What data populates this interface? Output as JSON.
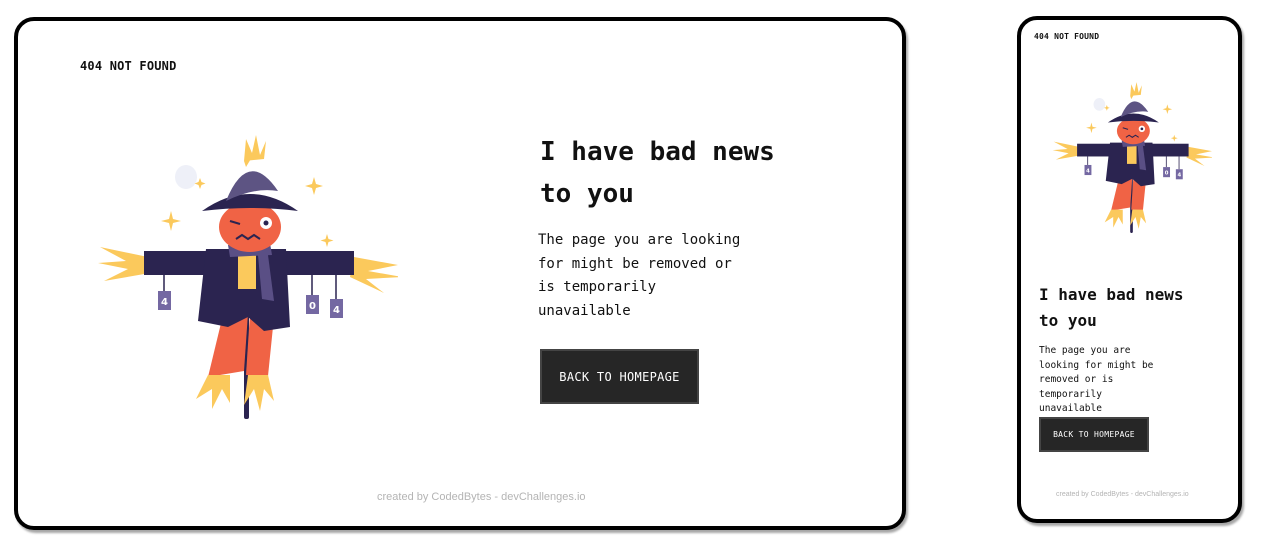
{
  "brand": "404 NOT FOUND",
  "headline": "I have bad news to you",
  "message": "The page you are looking for might be removed or is temporarily unavailable",
  "cta_label": "BACK TO HOMEPAGE",
  "credit": "created by CodedBytes - devChallenges.io",
  "illustration": {
    "subject": "scarecrow-illustration",
    "sign_digits": [
      "4",
      "0",
      "4"
    ],
    "icons": [
      "moon-icon",
      "sparkle-icon"
    ]
  },
  "colors": {
    "background": "#ffffff",
    "frame_border": "#000000",
    "text": "#111111",
    "button_bg": "#262626",
    "button_text": "#ffffff",
    "credit_text": "#b4b4b4",
    "hat_and_coat": "#2b2450",
    "hat_light": "#5d5483",
    "face_and_pants": "#f06345",
    "straw": "#fbc95c",
    "scarf": "#5a4f85",
    "moon": "#eef0f8"
  }
}
